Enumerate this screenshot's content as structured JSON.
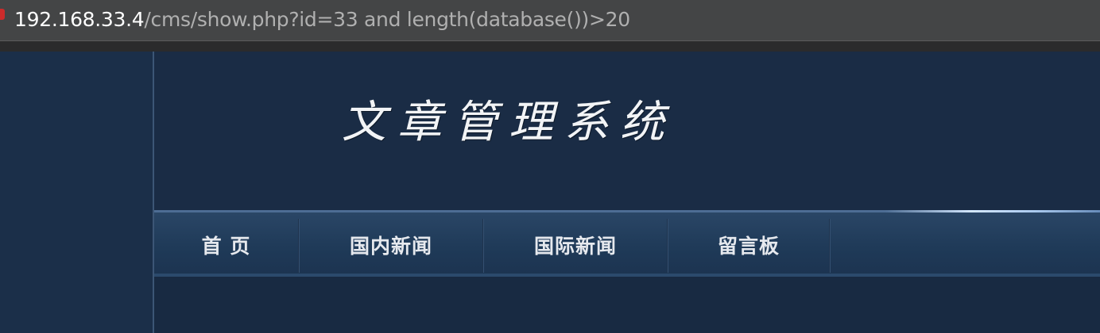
{
  "address_bar": {
    "host": "192.168.33.4",
    "path": "/cms/show.php?id=33 and length(database())>20"
  },
  "site": {
    "title": "文章管理系统"
  },
  "nav": {
    "items": [
      {
        "label": "首 页"
      },
      {
        "label": "国内新闻"
      },
      {
        "label": "国际新闻"
      },
      {
        "label": "留言板"
      }
    ]
  },
  "colors": {
    "page_bg": "#1a2c44",
    "nav_bg": "#1f3a58",
    "address_bar_bg": "#444546"
  }
}
